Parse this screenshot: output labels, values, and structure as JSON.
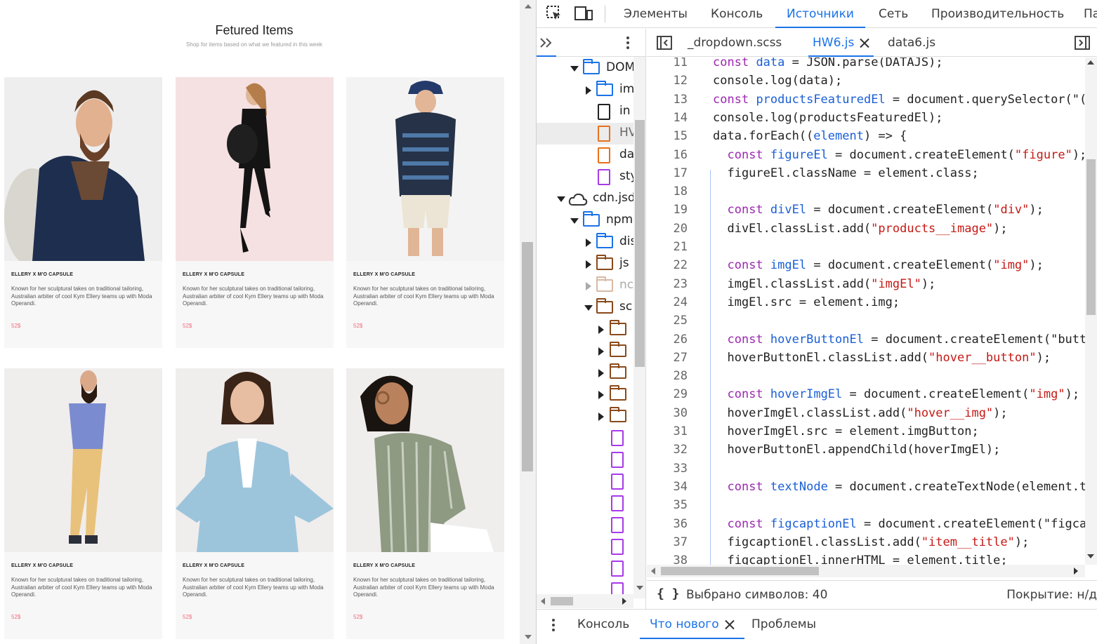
{
  "page": {
    "title": "Fetured Items",
    "subtitle": "Shop for items based on what we featured in this week",
    "products": [
      {
        "brand": "ELLERY X M'O CAPSULE",
        "description": "Known for her sculptural takes on traditional tailoring, Australian arbiter of cool Kym Ellery teams up with Moda Operandi.",
        "price": "52$",
        "bg": "#eeeeee",
        "photo": "man-backpack-photo"
      },
      {
        "brand": "ELLERY X M'O CAPSULE",
        "description": "Known for her sculptural takes on traditional tailoring, Australian arbiter of cool Kym Ellery teams up with Moda Operandi.",
        "price": "52$",
        "bg": "#f5e1e2",
        "photo": "woman-black-outfit-photo"
      },
      {
        "brand": "ELLERY X M'O CAPSULE",
        "description": "Known for her sculptural takes on traditional tailoring, Australian arbiter of cool Kym Ellery teams up with Moda Operandi.",
        "price": "52$",
        "bg": "#f4f3f3",
        "photo": "man-striped-hoodie-photo"
      },
      {
        "brand": "ELLERY X M'O CAPSULE",
        "description": "Known for her sculptural takes on traditional tailoring, Australian arbiter of cool Kym Ellery teams up with Moda Operandi.",
        "price": "52$",
        "bg": "#f0eded",
        "photo": "man-yellow-pants-photo"
      },
      {
        "brand": "ELLERY X M'O CAPSULE",
        "description": "Known for her sculptural takes on traditional tailoring, Australian arbiter of cool Kym Ellery teams up with Moda Operandi.",
        "price": "52$",
        "bg": "#f0eded",
        "photo": "woman-blue-blazer-photo"
      },
      {
        "brand": "ELLERY X M'O CAPSULE",
        "description": "Known for her sculptural takes on traditional tailoring, Australian arbiter of cool Kym Ellery teams up with Moda Operandi.",
        "price": "52$",
        "bg": "#f0eded",
        "photo": "woman-striped-jacket-photo"
      }
    ]
  },
  "devtools": {
    "tabs": [
      "Элементы",
      "Консоль",
      "Источники",
      "Сеть",
      "Производительность",
      "Па"
    ],
    "active_tab": "Источники",
    "file_tabs": [
      "_dropdown.scss",
      "HW6.js",
      "data6.js"
    ],
    "active_file": "HW6.js",
    "tree": [
      "DOM",
      "im",
      "in",
      "HV",
      "da",
      "sty",
      "cdn.jsd",
      "npm",
      "dis",
      "js",
      "nc",
      "sc"
    ],
    "code_lines": [
      {
        "n": "11",
        "text": "const data = JSON.parse(DATAJS);"
      },
      {
        "n": "12",
        "text": "console.log(data);"
      },
      {
        "n": "13",
        "text": "const productsFeaturedEl = document.querySelector(\"("
      },
      {
        "n": "14",
        "text": "console.log(productsFeaturedEl);"
      },
      {
        "n": "15",
        "text": "data.forEach((element) => {"
      },
      {
        "n": "16",
        "text": "  const figureEl = document.createElement(\"figure\");"
      },
      {
        "n": "17",
        "text": "  figureEl.className = element.class;"
      },
      {
        "n": "18",
        "text": ""
      },
      {
        "n": "19",
        "text": "  const divEl = document.createElement(\"div\");"
      },
      {
        "n": "20",
        "text": "  divEl.classList.add(\"products__image\");"
      },
      {
        "n": "21",
        "text": ""
      },
      {
        "n": "22",
        "text": "  const imgEl = document.createElement(\"img\");"
      },
      {
        "n": "23",
        "text": "  imgEl.classList.add(\"imgEl\");"
      },
      {
        "n": "24",
        "text": "  imgEl.src = element.img;"
      },
      {
        "n": "25",
        "text": ""
      },
      {
        "n": "26",
        "text": "  const hoverButtonEl = document.createElement(\"butt"
      },
      {
        "n": "27",
        "text": "  hoverButtonEl.classList.add(\"hover__button\");"
      },
      {
        "n": "28",
        "text": ""
      },
      {
        "n": "29",
        "text": "  const hoverImgEl = document.createElement(\"img\");"
      },
      {
        "n": "30",
        "text": "  hoverImgEl.classList.add(\"hover__img\");"
      },
      {
        "n": "31",
        "text": "  hoverImgEl.src = element.imgButton;"
      },
      {
        "n": "32",
        "text": "  hoverButtonEl.appendChild(hoverImgEl);"
      },
      {
        "n": "33",
        "text": ""
      },
      {
        "n": "34",
        "text": "  const textNode = document.createTextNode(element.t"
      },
      {
        "n": "35",
        "text": ""
      },
      {
        "n": "36",
        "text": "  const figcaptionEl = document.createElement(\"figca"
      },
      {
        "n": "37",
        "text": "  figcaptionEl.classList.add(\"item__title\");"
      },
      {
        "n": "38",
        "text": "  figcaptionEl.innerHTML = element.title;"
      }
    ],
    "status_selected": "Выбрано символов: 40",
    "status_coverage": "Покрытие: н/д",
    "drawer_tabs": [
      "Консоль",
      "Что нового",
      "Проблемы"
    ],
    "drawer_active": "Что нового",
    "colors": {
      "accent": "#1a73e8",
      "keyword": "#9c27b0",
      "string": "#c41a16",
      "variable": "#1a5fd6",
      "price": "#f16d7f"
    }
  }
}
